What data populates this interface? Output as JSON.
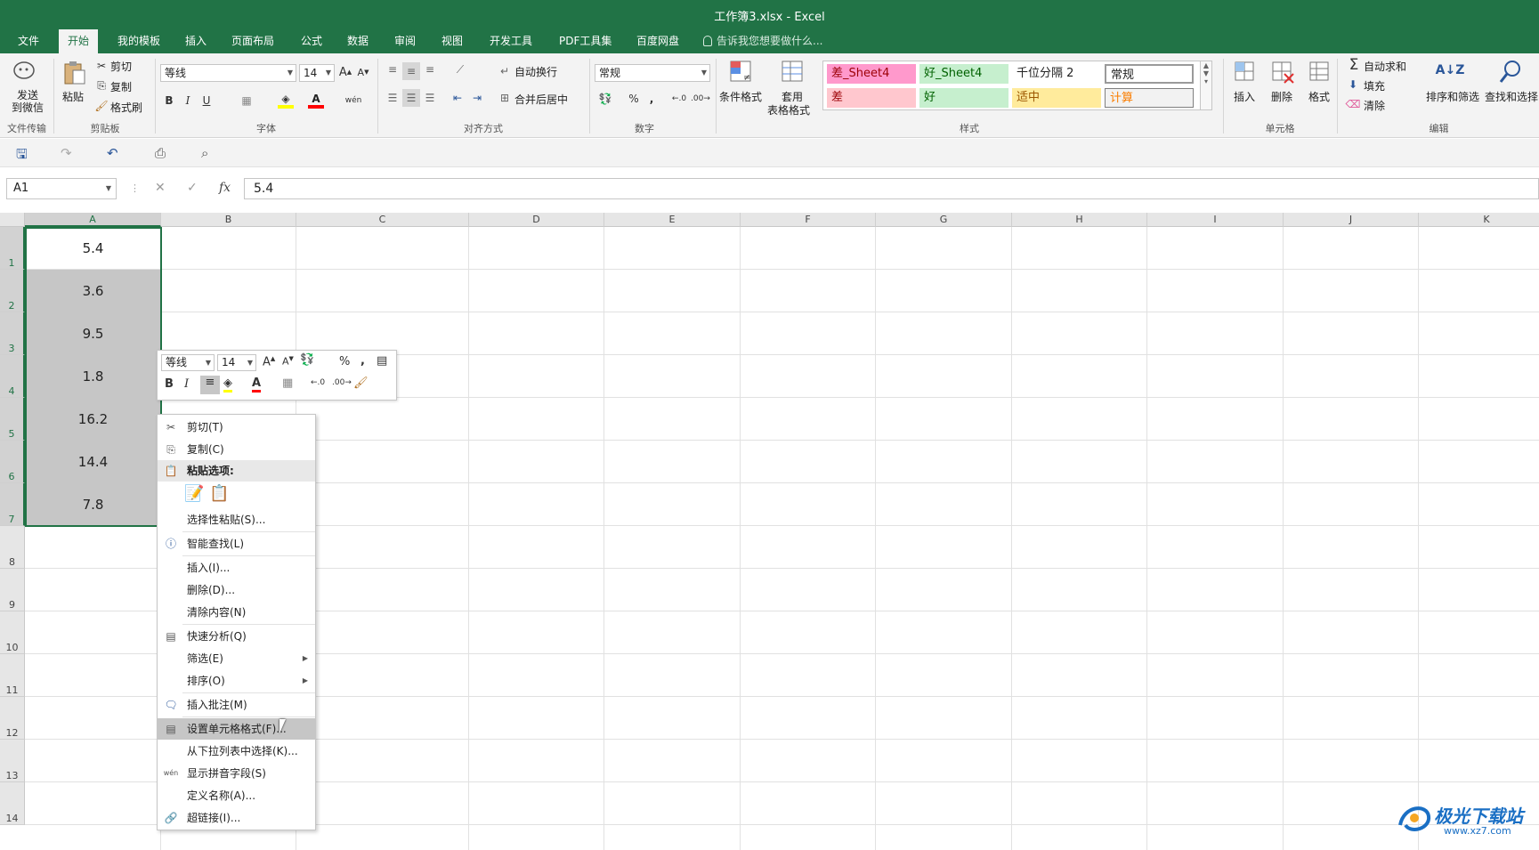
{
  "window": {
    "title": "工作簿3.xlsx - Excel"
  },
  "tabs": [
    "文件",
    "开始",
    "我的模板",
    "插入",
    "页面布局",
    "公式",
    "数据",
    "审阅",
    "视图",
    "开发工具",
    "PDF工具集",
    "百度网盘"
  ],
  "active_tab": "开始",
  "tell_me": "告诉我您想要做什么...",
  "ribbon": {
    "send_wechat": "发送\n到微信",
    "file_transfer": "文件传输",
    "paste": "粘贴",
    "cut": "剪切",
    "copy": "复制",
    "format_painter": "格式刷",
    "clipboard": "剪贴板",
    "font_name": "等线",
    "font_size": "14",
    "font_group": "字体",
    "wrap_text": "自动换行",
    "merge_center": "合并后居中",
    "alignment_group": "对齐方式",
    "number_format": "常规",
    "number_group": "数字",
    "conditional_format": "条件格式",
    "table_format_1": "套用",
    "table_format_2": "表格格式",
    "styles_group": "样式",
    "styles": [
      {
        "label": "差_Sheet4",
        "bg": "#ff99cc",
        "fg": "#9c0006"
      },
      {
        "label": "好_Sheet4",
        "bg": "#c6efce",
        "fg": "#006100"
      },
      {
        "label": "千位分隔 2",
        "bg": "#ffffff",
        "fg": "#222222"
      },
      {
        "label": "常规",
        "bg": "#ffffff",
        "fg": "#222222"
      },
      {
        "label": "差",
        "bg": "#ffc7ce",
        "fg": "#9c0006"
      },
      {
        "label": "好",
        "bg": "#c6efce",
        "fg": "#006100"
      },
      {
        "label": "适中",
        "bg": "#ffeb9c",
        "fg": "#9c5700"
      },
      {
        "label": "计算",
        "bg": "#f2f2f2",
        "fg": "#fa7d00"
      }
    ],
    "insert": "插入",
    "delete": "删除",
    "format": "格式",
    "cells_group": "单元格",
    "autosum": "自动求和",
    "fill": "填充",
    "clear": "清除",
    "sort_filter": "排序和筛选",
    "find_select": "查找和选择",
    "editing_group": "编辑"
  },
  "formula_bar": {
    "name_box": "A1",
    "value": "5.4",
    "fx": "fx"
  },
  "columns": [
    "A",
    "B",
    "C",
    "D",
    "E",
    "F",
    "G",
    "H",
    "I",
    "J",
    "K"
  ],
  "rows": [
    "1",
    "2",
    "3",
    "4",
    "5",
    "6",
    "7",
    "8",
    "9",
    "10",
    "11",
    "12",
    "13",
    "14"
  ],
  "cells_a": [
    "5.4",
    "3.6",
    "9.5",
    "1.8",
    "16.2",
    "14.4",
    "7.8"
  ],
  "mini_toolbar": {
    "font_name": "等线",
    "font_size": "14"
  },
  "context_menu": {
    "cut": "剪切(T)",
    "copy": "复制(C)",
    "paste_options": "粘贴选项:",
    "paste_special": "选择性粘贴(S)...",
    "smart_lookup": "智能查找(L)",
    "insert": "插入(I)...",
    "delete": "删除(D)...",
    "clear": "清除内容(N)",
    "quick_analysis": "快速分析(Q)",
    "filter": "筛选(E)",
    "sort": "排序(O)",
    "insert_comment": "插入批注(M)",
    "format_cells": "设置单元格格式(F)...",
    "pick_list": "从下拉列表中选择(K)...",
    "phonetic": "显示拼音字段(S)",
    "define_name": "定义名称(A)...",
    "hyperlink": "超链接(I)..."
  },
  "watermark": {
    "name": "极光下载站",
    "url": "www.xz7.com"
  },
  "colors": {
    "excel_green": "#217346",
    "selection_gray": "#c6c6c6"
  }
}
